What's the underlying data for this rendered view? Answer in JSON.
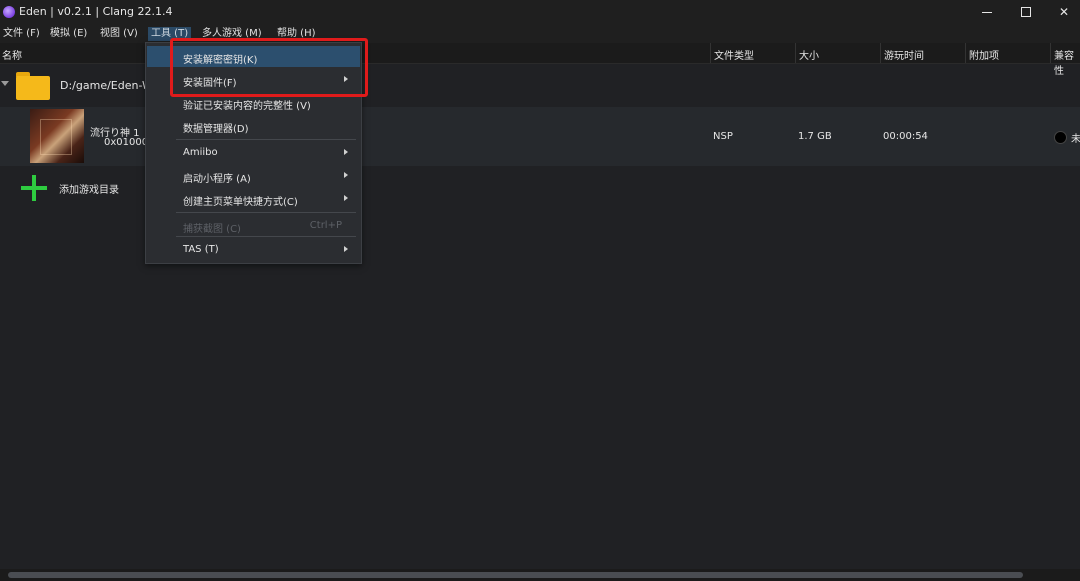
{
  "window": {
    "title": "Eden | v0.2.1 | Clang 22.1.4",
    "controls": [
      "minimize-icon",
      "maximize-icon",
      "close-icon"
    ]
  },
  "menubar": [
    {
      "label": "文件 (F)"
    },
    {
      "label": "模拟 (E)"
    },
    {
      "label": "视图 (V)"
    },
    {
      "label": "工具 (T)",
      "active": true
    },
    {
      "label": "多人游戏 (M)"
    },
    {
      "label": "帮助 (H)"
    }
  ],
  "columns": [
    "名称",
    "文件类型",
    "大小",
    "游玩时间",
    "附加项",
    "兼容性"
  ],
  "folder": {
    "path": "D:/game/Eden-W",
    "icon": "folder-icon"
  },
  "game": {
    "title": "流行り神 1",
    "id": "0x01000",
    "file_type": "NSP",
    "size": "1.7 GB",
    "play_time": "00:00:54",
    "compat_text": "未"
  },
  "add_dir": {
    "label": "添加游戏目录",
    "icon": "plus-icon"
  },
  "tools_menu": {
    "items": [
      {
        "label": "安装解密密钥(K)",
        "highlighted": true
      },
      {
        "label": "安装固件(F)",
        "submenu": true
      },
      {
        "label": "验证已安装内容的完整性 (V)"
      },
      {
        "label": "数据管理器(D)"
      },
      {
        "label": "Amiibo",
        "submenu": true
      },
      {
        "label": "启动小程序 (A)",
        "submenu": true
      },
      {
        "label": "创建主页菜单快捷方式(C)",
        "submenu": true
      },
      {
        "label": "捕获截图 (C)",
        "disabled": true,
        "shortcut": "Ctrl+P"
      },
      {
        "label": "TAS (T)",
        "submenu": true
      }
    ]
  },
  "colors": {
    "highlight_box": "#e01b1b",
    "menu_highlight": "#2c4f6e",
    "add_icon": "#2ecc40",
    "folder": "#f5b91a"
  }
}
